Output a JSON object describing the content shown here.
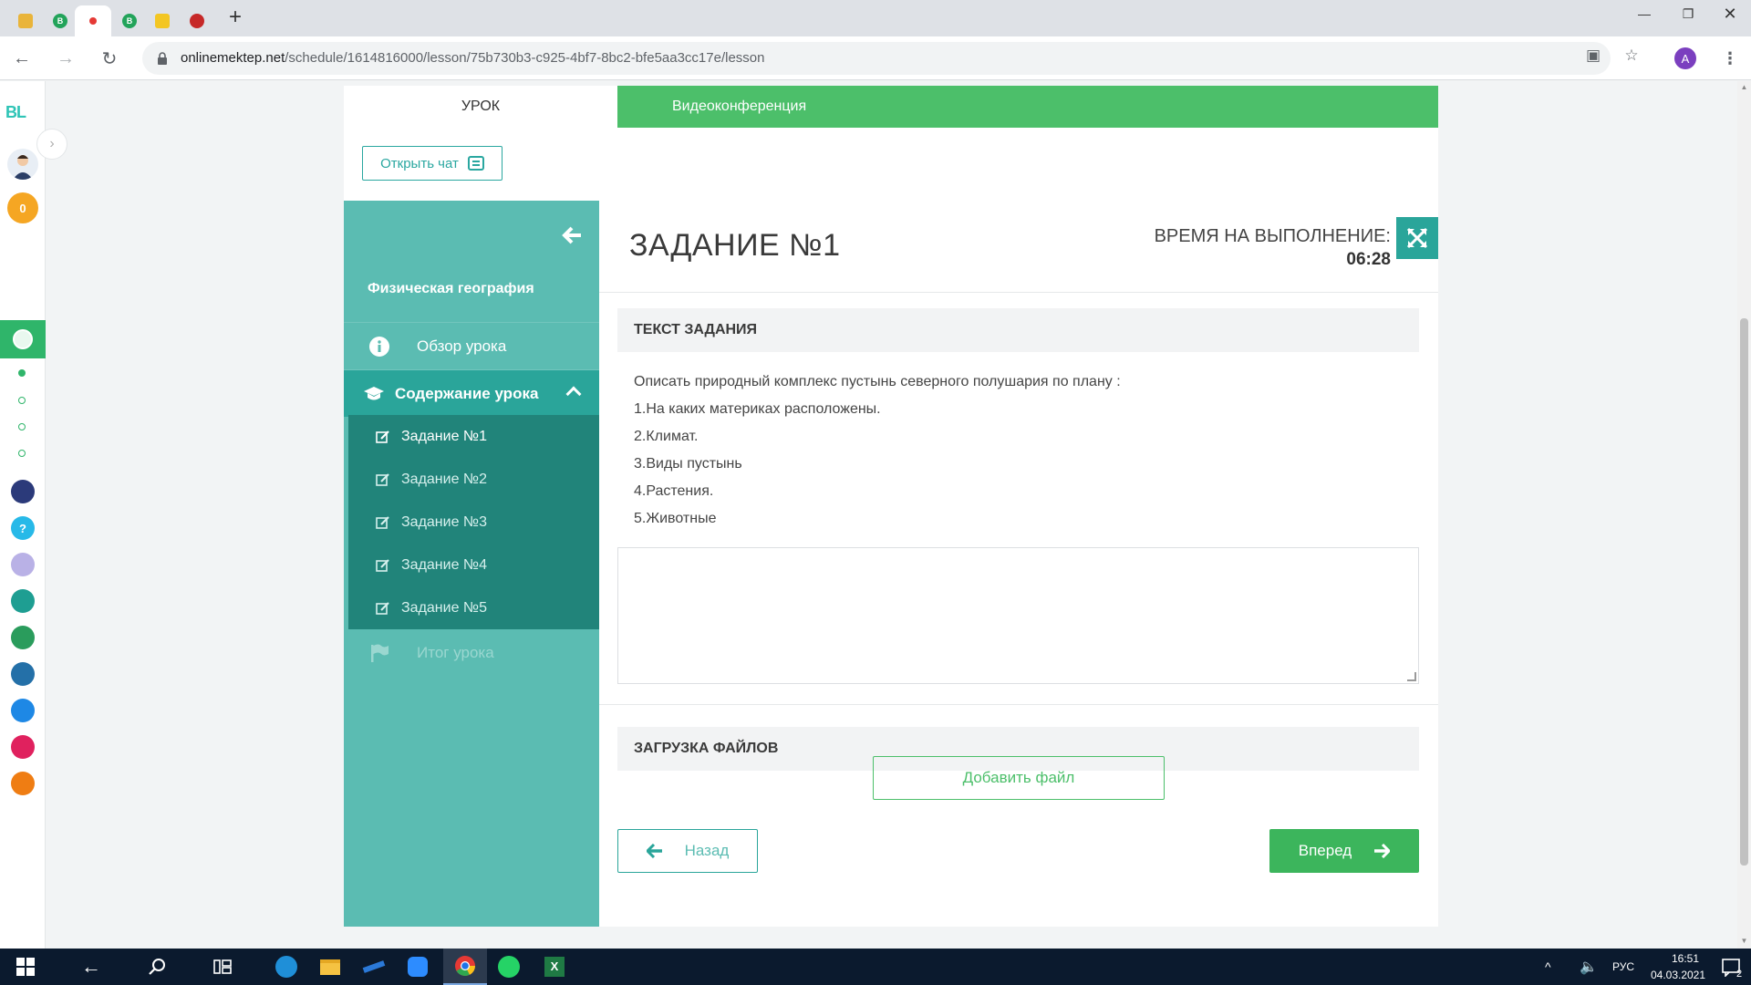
{
  "browser": {
    "url_host": "onlinemektep.net",
    "url_path": "/schedule/1614816000/lesson/75b730b3-c925-4bf7-8bc2-bfe5aa3cc17e/lesson",
    "profile_initial": "A"
  },
  "rail": {
    "logo": "BL",
    "badge_count": "0"
  },
  "tabs": {
    "lesson": "Урок",
    "video": "Видеоконференция"
  },
  "chat": {
    "open_label": "Открыть чат"
  },
  "sidebar": {
    "subject": "Физическая география",
    "overview": "Обзор урока",
    "content": "Содержание урока",
    "tasks": [
      "Задание №1",
      "Задание №2",
      "Задание №3",
      "Задание №4",
      "Задание №5"
    ],
    "summary": "Итог урока"
  },
  "task": {
    "title": "Задание №1",
    "timer_label": "Время на выполнение:",
    "timer_value": "06:28",
    "text_header": "Текст задания",
    "lines": [
      "Описать природный комплекс пустынь северного полушария по плану :",
      "1.На каких материках расположены.",
      "2.Климат.",
      "3.Виды пустынь",
      "4.Растения.",
      "5.Животные"
    ],
    "upload_header": "Загрузка файлов",
    "add_file": "Добавить файл",
    "back": "Назад",
    "next": "Вперед"
  },
  "taskbar": {
    "lang": "РУС",
    "time": "16:51",
    "date": "04.03.2021",
    "notifications": "2"
  },
  "colors": {
    "accent_green": "#4cbf6a",
    "teal": "#5bbcb2",
    "teal_dark": "#21847a"
  }
}
